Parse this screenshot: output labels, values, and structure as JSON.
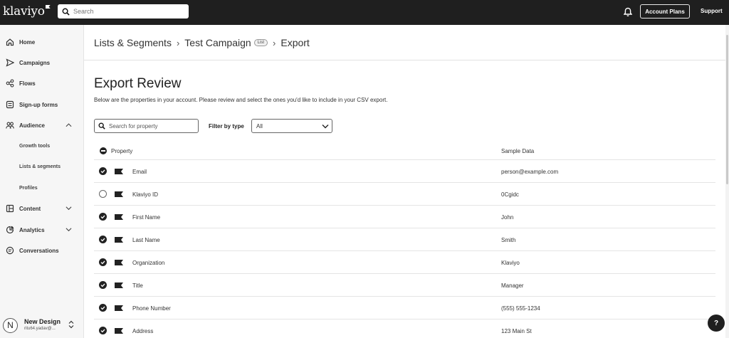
{
  "topbar": {
    "logo": "klaviyo",
    "search_placeholder": "Search",
    "account_plans_label": "Account Plans",
    "support_label": "Support"
  },
  "sidebar": {
    "items": [
      {
        "label": "Home",
        "icon": "home-icon"
      },
      {
        "label": "Campaigns",
        "icon": "send-icon"
      },
      {
        "label": "Flows",
        "icon": "flows-icon"
      },
      {
        "label": "Sign-up forms",
        "icon": "form-icon"
      },
      {
        "label": "Audience",
        "icon": "audience-icon"
      },
      {
        "label": "Content",
        "icon": "content-icon"
      },
      {
        "label": "Analytics",
        "icon": "analytics-icon"
      },
      {
        "label": "Conversations",
        "icon": "conversations-icon"
      }
    ],
    "audience_sub": [
      "Growth tools",
      "Lists & segments",
      "Profiles"
    ],
    "account": {
      "initial": "N",
      "name": "New Design",
      "email": "ritu64.yadav@..."
    }
  },
  "header": {
    "crumb_1": "Lists & Segments",
    "crumb_2": "Test Campaign",
    "crumb_2_badge": "List",
    "crumb_3": "Export"
  },
  "main": {
    "title": "Export Review",
    "subtitle": "Below are the properties in your account. Please review and select the ones you'd like to include in your CSV export.",
    "search_placeholder": "Search for property",
    "filter_label": "Filter by type",
    "filter_value": "All",
    "columns": {
      "property": "Property",
      "sample": "Sample Data"
    },
    "rows": [
      {
        "name": "Email",
        "sample": "person@example.com",
        "checked": true
      },
      {
        "name": "Klaviyo ID",
        "sample": "0Cgidc",
        "checked": false
      },
      {
        "name": "First Name",
        "sample": "John",
        "checked": true
      },
      {
        "name": "Last Name",
        "sample": "Smith",
        "checked": true
      },
      {
        "name": "Organization",
        "sample": "Klaviyo",
        "checked": true
      },
      {
        "name": "Title",
        "sample": "Manager",
        "checked": true
      },
      {
        "name": "Phone Number",
        "sample": "(555) 555-1234",
        "checked": true
      },
      {
        "name": "Address",
        "sample": "123 Main St",
        "checked": true
      }
    ]
  },
  "help_label": "?"
}
